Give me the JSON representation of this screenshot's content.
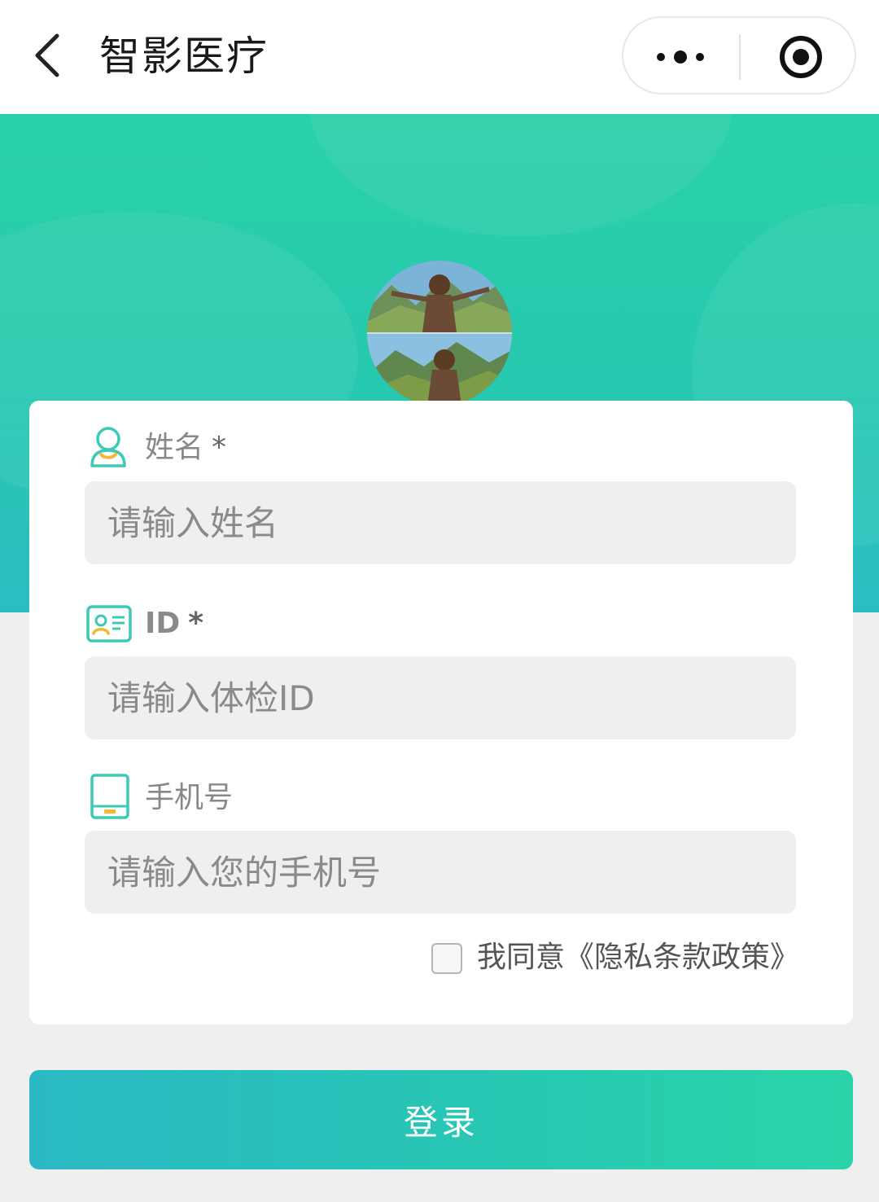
{
  "nav": {
    "title": "智影医疗",
    "back_icon": "chevron-left-icon",
    "more_icon": "more-dots-icon",
    "close_icon": "target-circle-icon"
  },
  "hero": {
    "avatar": "avatar-image"
  },
  "form": {
    "name": {
      "label": "姓名",
      "required": "*",
      "placeholder": "请输入姓名",
      "icon": "user-icon"
    },
    "id": {
      "label": "ID",
      "required": "*",
      "placeholder": "请输入体检ID",
      "icon": "id-card-icon"
    },
    "phone": {
      "label": "手机号",
      "placeholder": "请输入您的手机号",
      "icon": "tablet-icon"
    },
    "agree_text": "我同意《隐私条款政策》"
  },
  "login_label": "登录",
  "colors": {
    "accent": "#2ad1a8",
    "accent_blue": "#2ab9c4",
    "icon_yellow": "#f7b733"
  }
}
